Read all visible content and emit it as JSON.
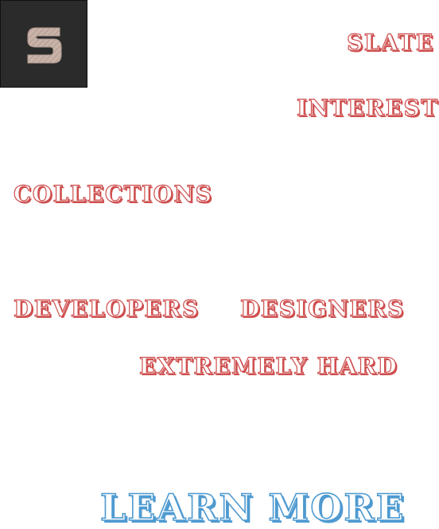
{
  "logo": {
    "letter": "S",
    "icon": "slate-logo-icon",
    "background": "#2b2b2b",
    "letter_color": "#c9b3a8"
  },
  "words": {
    "slate": "SLATE",
    "interests": "INTERESTS",
    "collections": "COLLECTIONS",
    "developers": "DEVELOPERS",
    "designers": "DESIGNERS",
    "extremely_hard": "EXTREMELY HARD"
  },
  "cta": {
    "label": "LEARN MORE"
  },
  "colors": {
    "accent_red": "#cf4f4f",
    "accent_blue": "#4e9ad1"
  }
}
